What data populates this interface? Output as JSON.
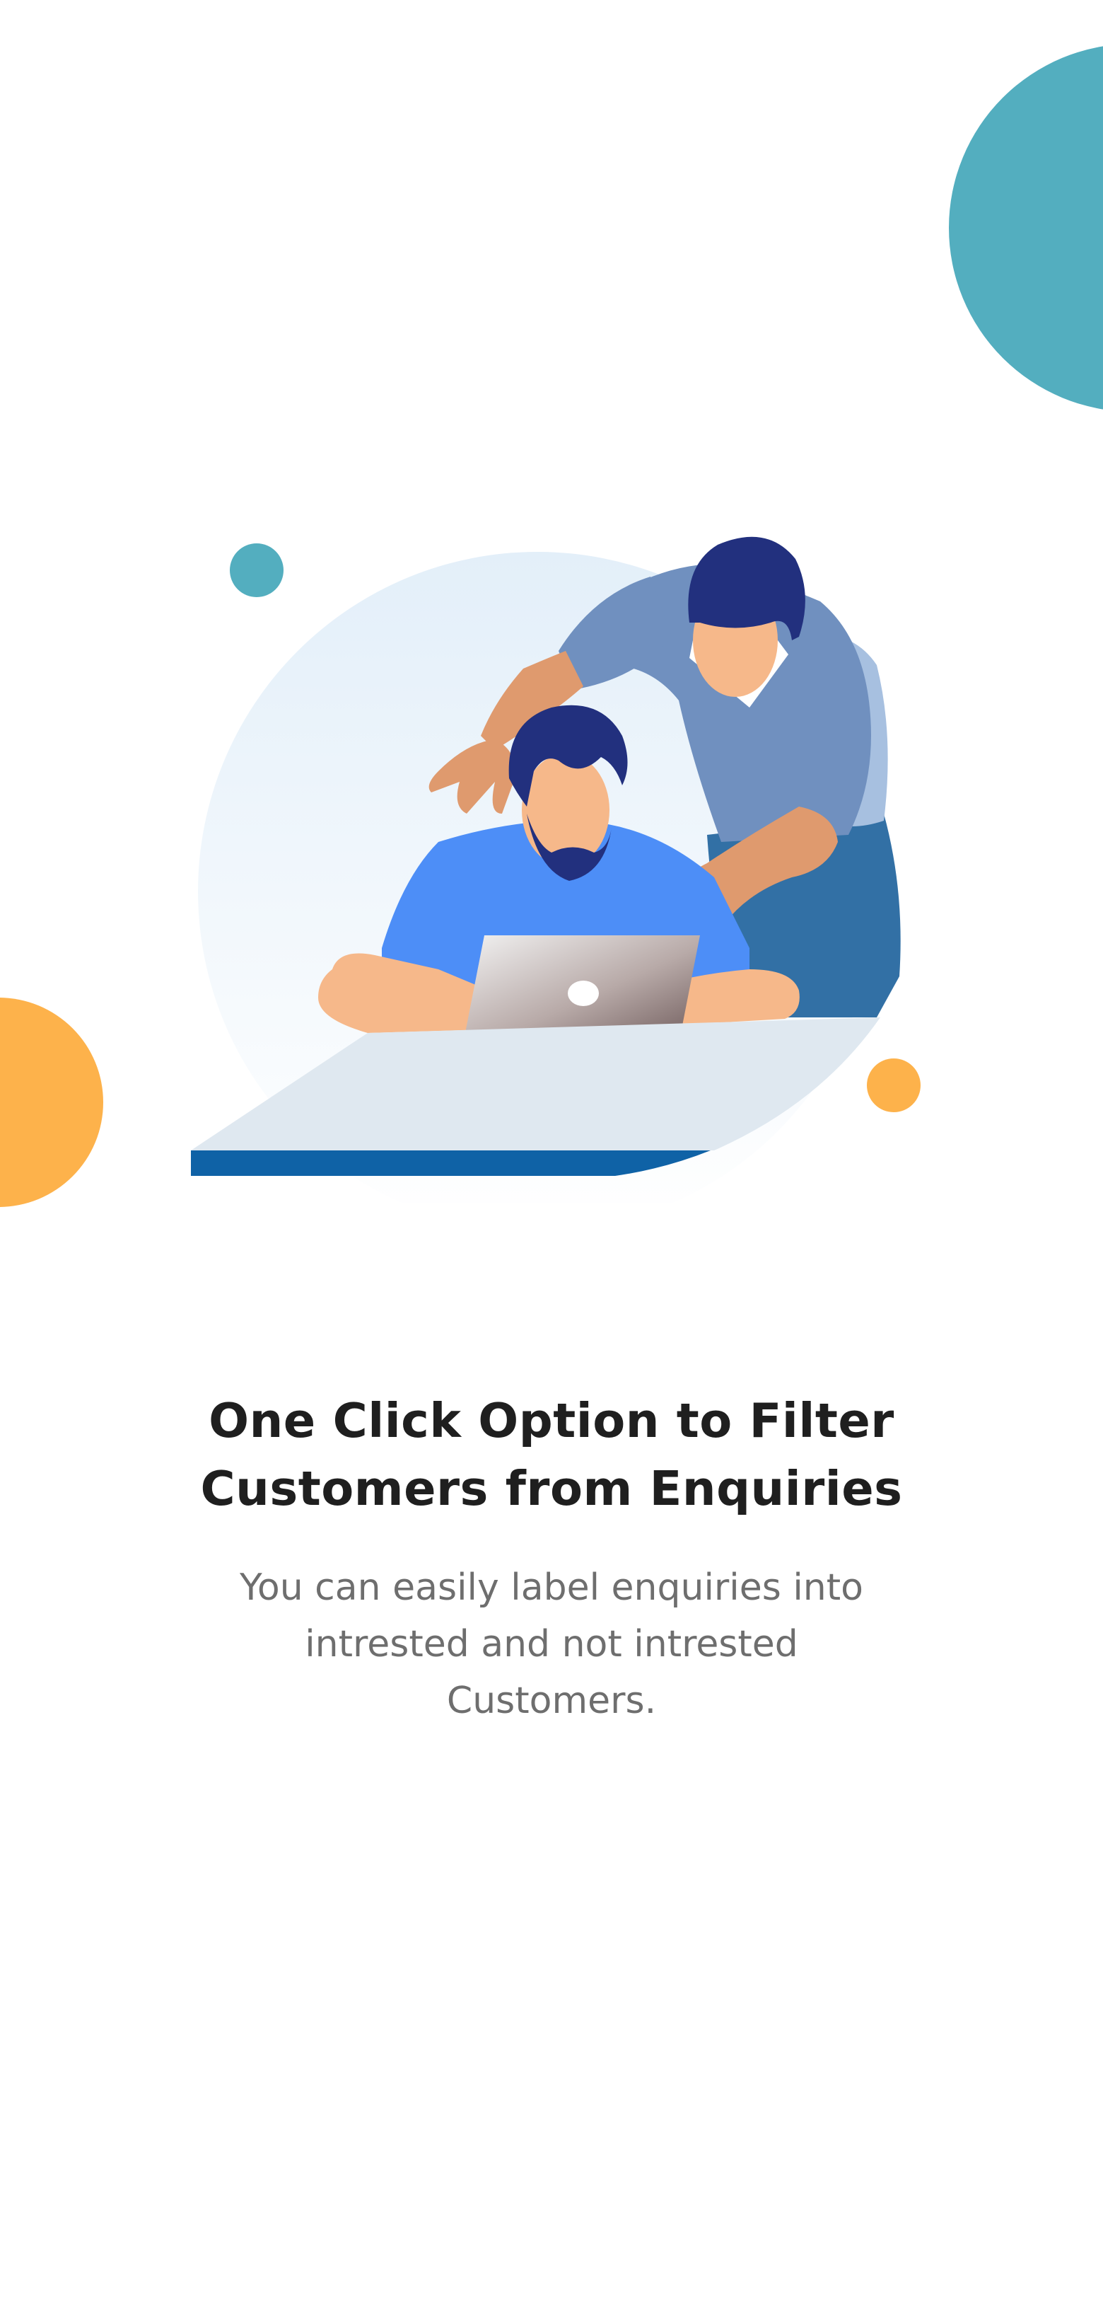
{
  "colors": {
    "teal": "#53aebf",
    "orange": "#fdb24b",
    "title_text": "#1f1f1f",
    "body_text": "#6e6e6e",
    "desk_top": "#dfe8f0",
    "desk_edge": "#0f62a6",
    "shirt_blue": "#4d8ef7",
    "hair_navy": "#22307e",
    "skin": "#f6b88a",
    "vest": "#7090bf",
    "pants": "#3270a5"
  },
  "illustration": {
    "icon": "two-men-working-at-laptop-illustration"
  },
  "onboarding": {
    "title": "One Click Option to Filter Customers from Enquiries",
    "description": "You can easily label enquiries into intrested and not intrested Customers."
  }
}
